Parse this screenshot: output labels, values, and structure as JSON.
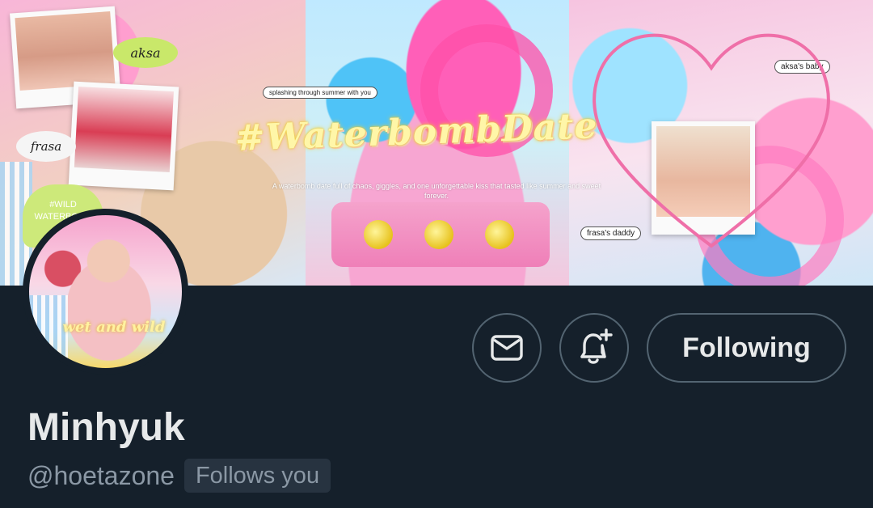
{
  "banner": {
    "title": "#WaterbombDate",
    "subtitle": "A waterbomb date full of chaos, giggles, and one unforgettable kiss that tasted like summer and sweet forever.",
    "sticker_aksa": "aksa",
    "sticker_frasa": "frasa",
    "heart_sticker": "#WILD WATERBOMB",
    "label_splash": "splashing through summer with you",
    "label_aksa_baby": "aksa's baby",
    "label_frasa_daddy": "frasa's daddy"
  },
  "avatar": {
    "text": "wet and wild"
  },
  "actions": {
    "message_icon": "envelope-icon",
    "notify_icon": "bell-plus-icon",
    "following_label": "Following"
  },
  "profile": {
    "display_name": "Minhyuk",
    "handle": "@hoetazone",
    "follows_you": "Follows you"
  },
  "colors": {
    "background": "#15202b",
    "text_primary": "#e7e9ea",
    "text_secondary": "#8b98a5",
    "border": "#536471",
    "badge_bg": "#273340"
  }
}
